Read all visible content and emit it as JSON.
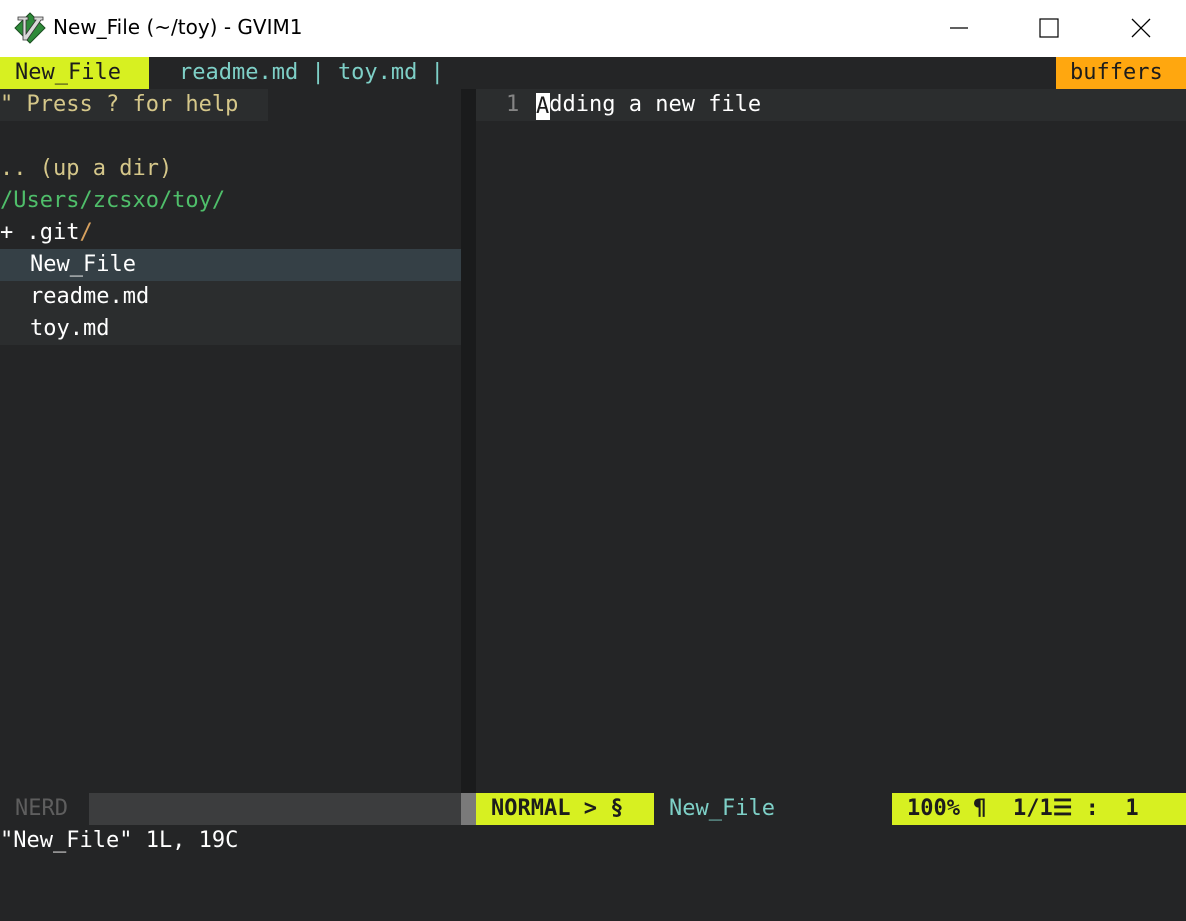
{
  "window": {
    "title": "New_File (~/toy) - GVIM1",
    "icon": "vim-icon",
    "controls": [
      "minimize-icon",
      "maximize-icon",
      "close-icon"
    ]
  },
  "tabline": {
    "active_tab": "New_File",
    "other_tabs": "readme.md | toy.md |",
    "buffers_label": "buffers"
  },
  "nerdtree": {
    "help": "\" Press ? for help",
    "up_dir": ".. (up a dir)",
    "root": "/Users/zcsxo/toy/",
    "git_prefix": "+ .git",
    "git_slash": "/",
    "files": [
      "New_File",
      "readme.md",
      "toy.md"
    ]
  },
  "editor": {
    "line_number": "1",
    "cursor_char": "A",
    "line_rest": "dding a new file"
  },
  "status": {
    "nerd_mode": "NERD",
    "mode": "NORMAL > §",
    "filename": "New_File",
    "position": "100% ¶  1/1☰ :  1"
  },
  "cmdline": "\"New_File\" 1L, 19C",
  "colors": {
    "accent_yellow": "#d7f021",
    "accent_orange": "#ffa70f",
    "background": "#242526",
    "teal": "#7ed0c7"
  }
}
